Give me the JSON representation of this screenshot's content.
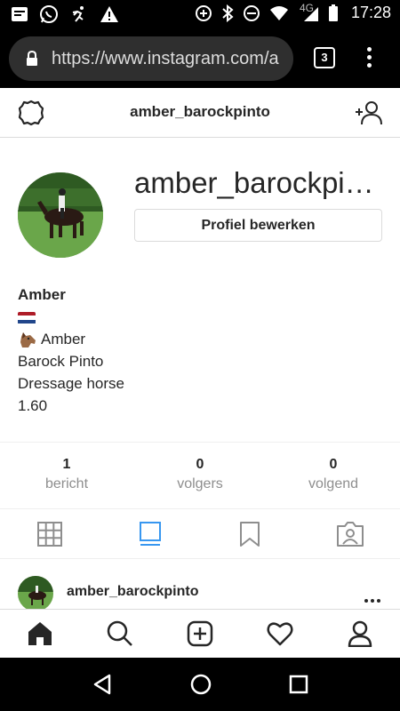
{
  "status_bar": {
    "network": "4G",
    "time": "17:28",
    "icons": [
      "news-icon",
      "whatsapp-icon",
      "activity-icon",
      "warning-icon",
      "data-saver-icon",
      "bluetooth-icon",
      "dnd-icon",
      "wifi-icon",
      "signal-icon",
      "battery-icon"
    ]
  },
  "browser": {
    "url": "https://www.instagram.com/a",
    "tab_count": "3"
  },
  "header": {
    "username": "amber_barockpinto",
    "icons": [
      "settings-icon",
      "add-person-icon"
    ]
  },
  "profile": {
    "name": "amber_barockpinto",
    "edit_label": "Profiel bewerken",
    "bio_name": "Amber",
    "bio_line1": "Amber",
    "bio_line2": "Barock Pinto",
    "bio_line3": "Dressage horse",
    "bio_line4": "1.60",
    "flag_colors": [
      "#ae1c28",
      "#ffffff",
      "#21468b"
    ]
  },
  "stats": [
    {
      "value": "1",
      "label": "bericht"
    },
    {
      "value": "0",
      "label": "volgers"
    },
    {
      "value": "0",
      "label": "volgend"
    }
  ],
  "view_tabs": [
    {
      "icon": "grid-icon",
      "active": false
    },
    {
      "icon": "feed-icon",
      "active": true
    },
    {
      "icon": "bookmark-icon",
      "active": false
    },
    {
      "icon": "tagged-icon",
      "active": false
    }
  ],
  "post": {
    "username": "amber_barockpinto"
  },
  "bottom_nav": [
    "home-icon",
    "search-icon",
    "new-post-icon",
    "activity-heart-icon",
    "profile-icon"
  ],
  "colors": {
    "accent": "#3897f0",
    "text": "#262626",
    "muted": "#8e8e8e",
    "border": "#dbdbdb"
  }
}
